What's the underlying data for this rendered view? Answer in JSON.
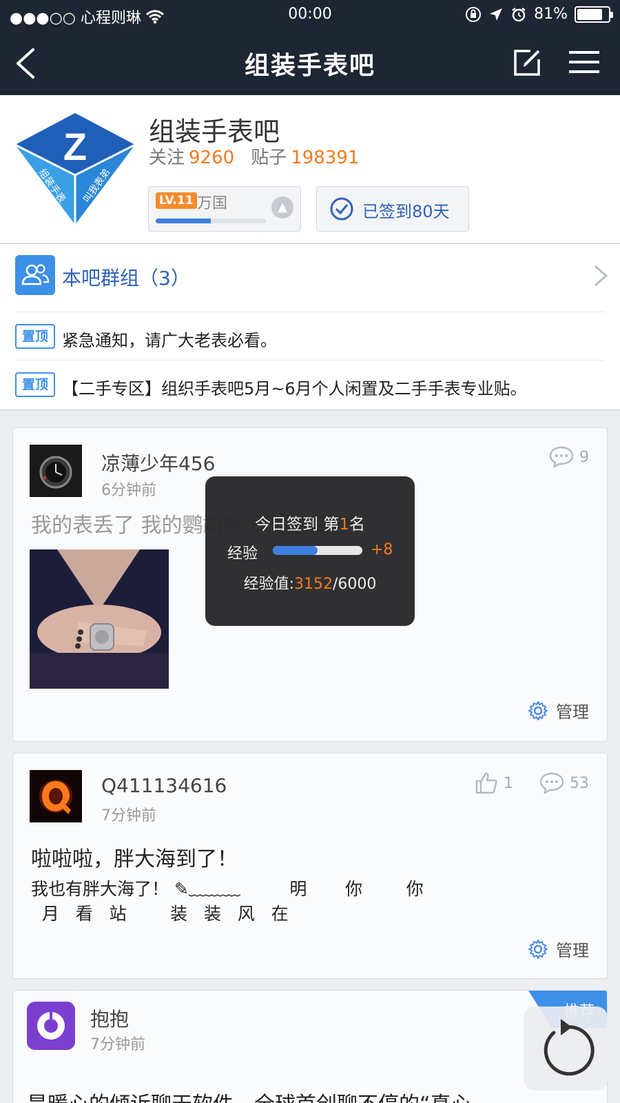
{
  "status_bar": {
    "carrier": "●●●○○ 心程则琳",
    "time": "00:00",
    "battery": "81%",
    "battery_level": 0.81
  },
  "nav": {
    "title": "组装手表吧"
  },
  "forum": {
    "name": "组装手表吧",
    "follow_label": "关注",
    "follow_count": "9260",
    "posts_label": "贴子",
    "posts_count": "198391",
    "logo_letter": "Z",
    "logo_text_left": "组装手表",
    "logo_text_right": "叫我表弟",
    "level_badge": "LV.11",
    "level_name": "万国",
    "level_progress": 0.5,
    "signed_label": "已签到80天"
  },
  "groups": {
    "label": "本吧群组（3）"
  },
  "pinned": [
    {
      "tag": "置顶",
      "text": "紧急通知，请广大老表必看。"
    },
    {
      "tag": "置顶",
      "text": "【二手专区】组织手表吧5月~6月个人闲置及二手手表专业贴。"
    }
  ],
  "posts": [
    {
      "author": "凉薄少年456",
      "time": "6分钟前",
      "comments": "9",
      "title": "我的表丢了 我的鹦鹉呢 就这么丢了",
      "manage": "管理"
    },
    {
      "author": "Q411134616",
      "time": "7分钟前",
      "likes": "1",
      "comments": "53",
      "title": "啦啦啦，胖大海到了！",
      "body_line1": "我也有胖大海了！ ✎﹏﹏﹏         明       你        你",
      "body_line2": "  月   看   站        装   装   风   在",
      "manage": "管理"
    },
    {
      "author": "抱抱",
      "time": "7分钟前",
      "tag": "推荐",
      "title": "是暖心的倾诉聊天软件，全球首创聊不停的“真心..."
    }
  ],
  "toast": {
    "line1_prefix": "今日签到 第",
    "rank": "1",
    "line1_suffix": "名",
    "exp_label": "经验",
    "exp_gain": "+8",
    "exp_value_label": "经验值:",
    "exp_current": "3152",
    "exp_total": "/6000",
    "exp_progress": 0.5
  },
  "colors": {
    "nav_bg": "#1f2633",
    "accent_blue": "#3d90e8",
    "accent_orange": "#f47a1e"
  }
}
